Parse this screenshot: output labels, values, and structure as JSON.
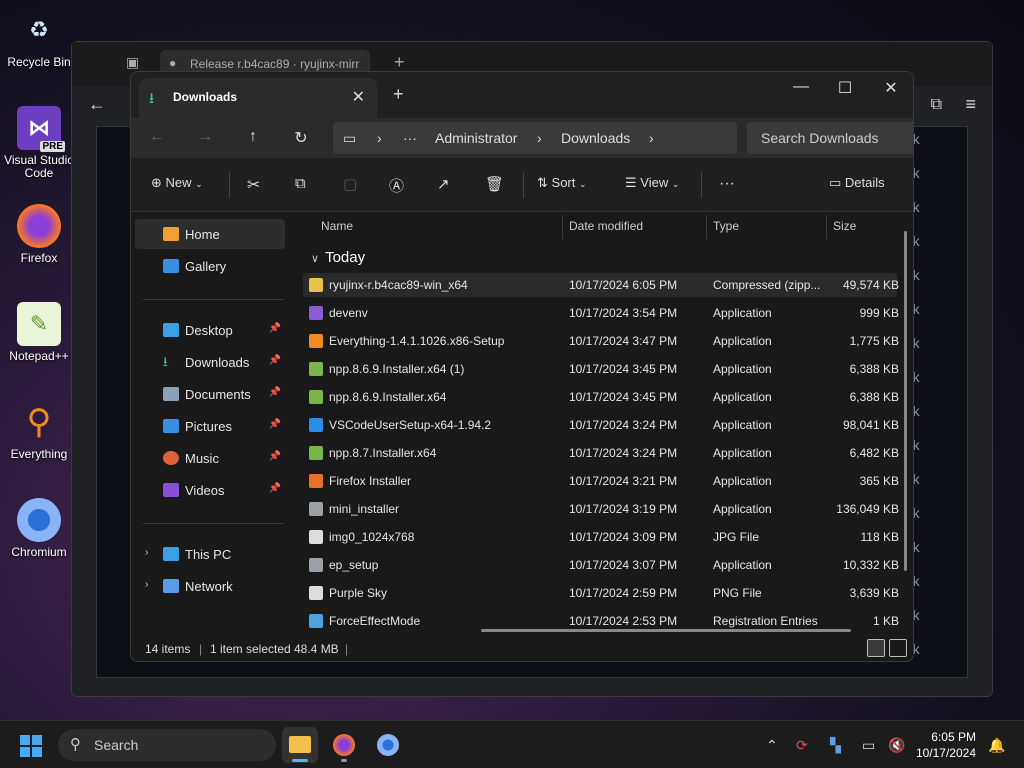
{
  "desktop": {
    "icons": [
      {
        "label": "Recycle Bin"
      },
      {
        "label": "Visual Studio Code",
        "badge": "PRE"
      },
      {
        "label": "Firefox"
      },
      {
        "label": "Notepad++"
      },
      {
        "label": "Everything"
      },
      {
        "label": "Chromium"
      }
    ]
  },
  "browser": {
    "tab_title": "Release r.b4cac89 · ryujinx-mirr",
    "new_tab": "+",
    "week_label": "eek"
  },
  "explorer": {
    "tab": {
      "title": "Downloads",
      "close": "✕"
    },
    "new_tab": "+",
    "window": {
      "minimize": "—",
      "maximize": "☐",
      "close": "✕"
    },
    "nav": {
      "back": "←",
      "forward": "→",
      "up": "↑",
      "refresh": "↻"
    },
    "address": {
      "more": "···",
      "crumb1": "Administrator",
      "crumb2": "Downloads",
      "sep": "›"
    },
    "search": {
      "placeholder": "Search Downloads"
    },
    "commands": {
      "new": "New",
      "sort": "Sort",
      "view": "View",
      "more": "···",
      "details": "Details"
    },
    "sidebar": {
      "home": "Home",
      "gallery": "Gallery",
      "desktop": "Desktop",
      "downloads": "Downloads",
      "documents": "Documents",
      "pictures": "Pictures",
      "music": "Music",
      "videos": "Videos",
      "this_pc": "This PC",
      "network": "Network"
    },
    "columns": {
      "name": "Name",
      "date": "Date modified",
      "type": "Type",
      "size": "Size"
    },
    "group": "Today",
    "files": [
      {
        "name": "ryujinx-r.b4cac89-win_x64",
        "date": "10/17/2024 6:05 PM",
        "type": "Compressed (zipp...",
        "size": "49,574 KB",
        "color": "#e8c24a"
      },
      {
        "name": "devenv",
        "date": "10/17/2024 3:54 PM",
        "type": "Application",
        "size": "999 KB",
        "color": "#8a5cd8"
      },
      {
        "name": "Everything-1.4.1.1026.x86-Setup",
        "date": "10/17/2024 3:47 PM",
        "type": "Application",
        "size": "1,775 KB",
        "color": "#f08a24"
      },
      {
        "name": "npp.8.6.9.Installer.x64 (1)",
        "date": "10/17/2024 3:45 PM",
        "type": "Application",
        "size": "6,388 KB",
        "color": "#7ab648"
      },
      {
        "name": "npp.8.6.9.Installer.x64",
        "date": "10/17/2024 3:45 PM",
        "type": "Application",
        "size": "6,388 KB",
        "color": "#7ab648"
      },
      {
        "name": "VSCodeUserSetup-x64-1.94.2",
        "date": "10/17/2024 3:24 PM",
        "type": "Application",
        "size": "98,041 KB",
        "color": "#2b8ee6"
      },
      {
        "name": "npp.8.7.Installer.x64",
        "date": "10/17/2024 3:24 PM",
        "type": "Application",
        "size": "6,482 KB",
        "color": "#7ab648"
      },
      {
        "name": "Firefox Installer",
        "date": "10/17/2024 3:21 PM",
        "type": "Application",
        "size": "365 KB",
        "color": "#e8702a"
      },
      {
        "name": "mini_installer",
        "date": "10/17/2024 3:19 PM",
        "type": "Application",
        "size": "136,049 KB",
        "color": "#9aa0a6"
      },
      {
        "name": "img0_1024x768",
        "date": "10/17/2024 3:09 PM",
        "type": "JPG File",
        "size": "118 KB",
        "color": "#dddddd"
      },
      {
        "name": "ep_setup",
        "date": "10/17/2024 3:07 PM",
        "type": "Application",
        "size": "10,332 KB",
        "color": "#9aa0a6"
      },
      {
        "name": "Purple Sky",
        "date": "10/17/2024 2:59 PM",
        "type": "PNG File",
        "size": "3,639 KB",
        "color": "#dddddd"
      },
      {
        "name": "ForceEffectMode",
        "date": "10/17/2024 2:53 PM",
        "type": "Registration Entries",
        "size": "1 KB",
        "color": "#4aa3df"
      }
    ],
    "status": {
      "items": "14 items",
      "selected": "1 item selected",
      "size": "48.4 MB"
    }
  },
  "taskbar": {
    "search": "Search",
    "time": "6:05 PM",
    "date": "10/17/2024"
  }
}
